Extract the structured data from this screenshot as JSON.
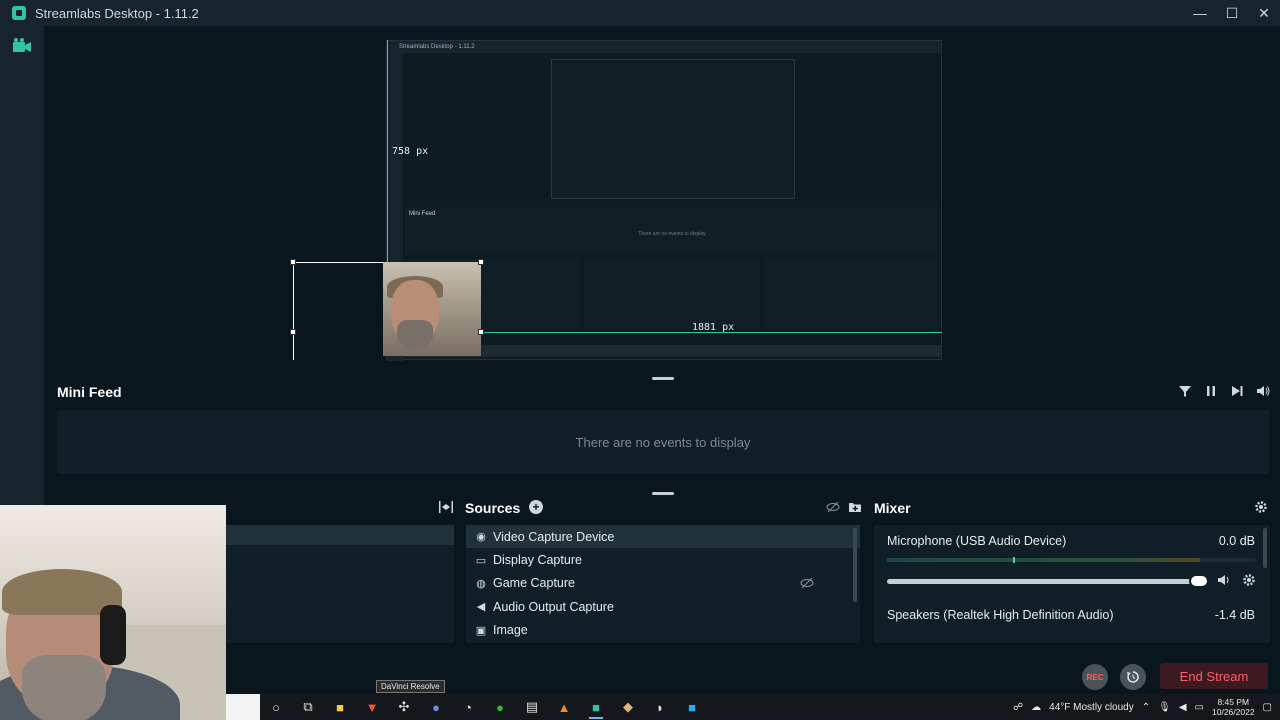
{
  "window": {
    "title": "Streamlabs Desktop - 1.11.2",
    "controls": {
      "minimize": "—",
      "maximize": "☐",
      "close": "✕"
    }
  },
  "preview": {
    "nested_title": "Streamlabs Desktop - 1.11.2",
    "nested_feed_label": "Mini Feed",
    "nested_feed_empty": "There are no events to display",
    "height_readout": "758 px",
    "width_readout": "1881 px"
  },
  "mini_feed": {
    "title": "Mini Feed",
    "empty_message": "There are no events to display",
    "icons": [
      "filter-icon",
      "pause-icon",
      "skip-icon",
      "volume-icon"
    ]
  },
  "sources": {
    "title": "Sources",
    "items": [
      {
        "label": "Video Capture Device",
        "icon": "webcam-icon",
        "selected": true
      },
      {
        "label": "Display Capture",
        "icon": "monitor-icon",
        "selected": false
      },
      {
        "label": "Game Capture",
        "icon": "gamepad-icon",
        "selected": false,
        "hidden": true
      },
      {
        "label": "Audio Output Capture",
        "icon": "speaker-icon",
        "selected": false
      },
      {
        "label": "Image",
        "icon": "image-icon",
        "selected": false
      }
    ]
  },
  "mixer": {
    "title": "Mixer",
    "channels": [
      {
        "name": "Microphone (USB Audio Device)",
        "db": "0.0 dB",
        "volume": 0.98
      },
      {
        "name": "Speakers (Realtek High Definition Audio)",
        "db": "-1.4 dB"
      }
    ]
  },
  "footer": {
    "rec_label": "REC",
    "end_stream_label": "End Stream"
  },
  "taskbar": {
    "tooltip": "DaVinci Resolve",
    "weather": "44°F  Mostly cloudy",
    "time": "8:45 PM",
    "date": "10/26/2022"
  },
  "colors": {
    "accent": "#31c3a2",
    "background": "#09161d",
    "panel": "#101f27",
    "end_stream": "#ff5e6a"
  }
}
